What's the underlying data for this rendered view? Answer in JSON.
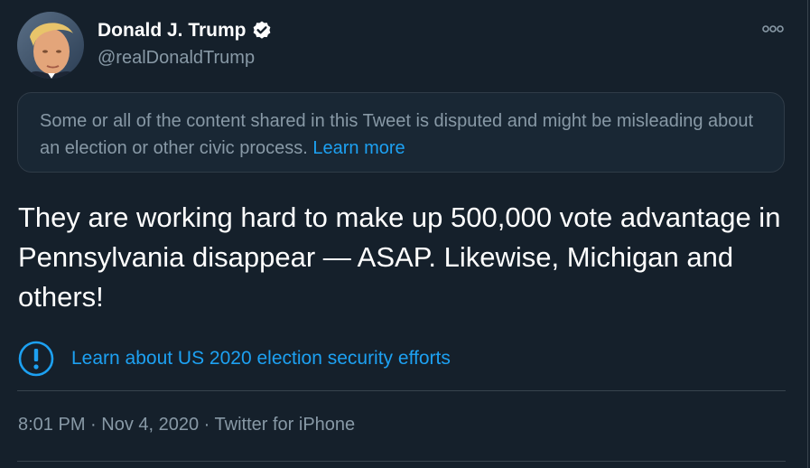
{
  "author": {
    "name": "Donald J. Trump",
    "handle": "@realDonaldTrump",
    "verified": true
  },
  "icons": {
    "verified": "verified-badge-icon",
    "more": "more-horizontal-icon",
    "election": "exclamation-circle-icon"
  },
  "notice": {
    "text": "Some or all of the content shared in this Tweet is disputed and might be misleading about an election or other civic process.",
    "link_label": "Learn more"
  },
  "tweet": {
    "text": "They are working hard to make up 500,000 vote advantage in Pennsylvania disappear — ASAP. Likewise, Michigan and others!"
  },
  "election_label": {
    "text": "Learn about US 2020 election security efforts"
  },
  "meta": {
    "time": "8:01 PM",
    "separator": " · ",
    "date": "Nov 4, 2020",
    "source": "Twitter for iPhone"
  },
  "colors": {
    "background": "#15202b",
    "notice_background": "#192734",
    "accent": "#1da1f2",
    "secondary_text": "#8899a6",
    "divider": "#38444d"
  }
}
